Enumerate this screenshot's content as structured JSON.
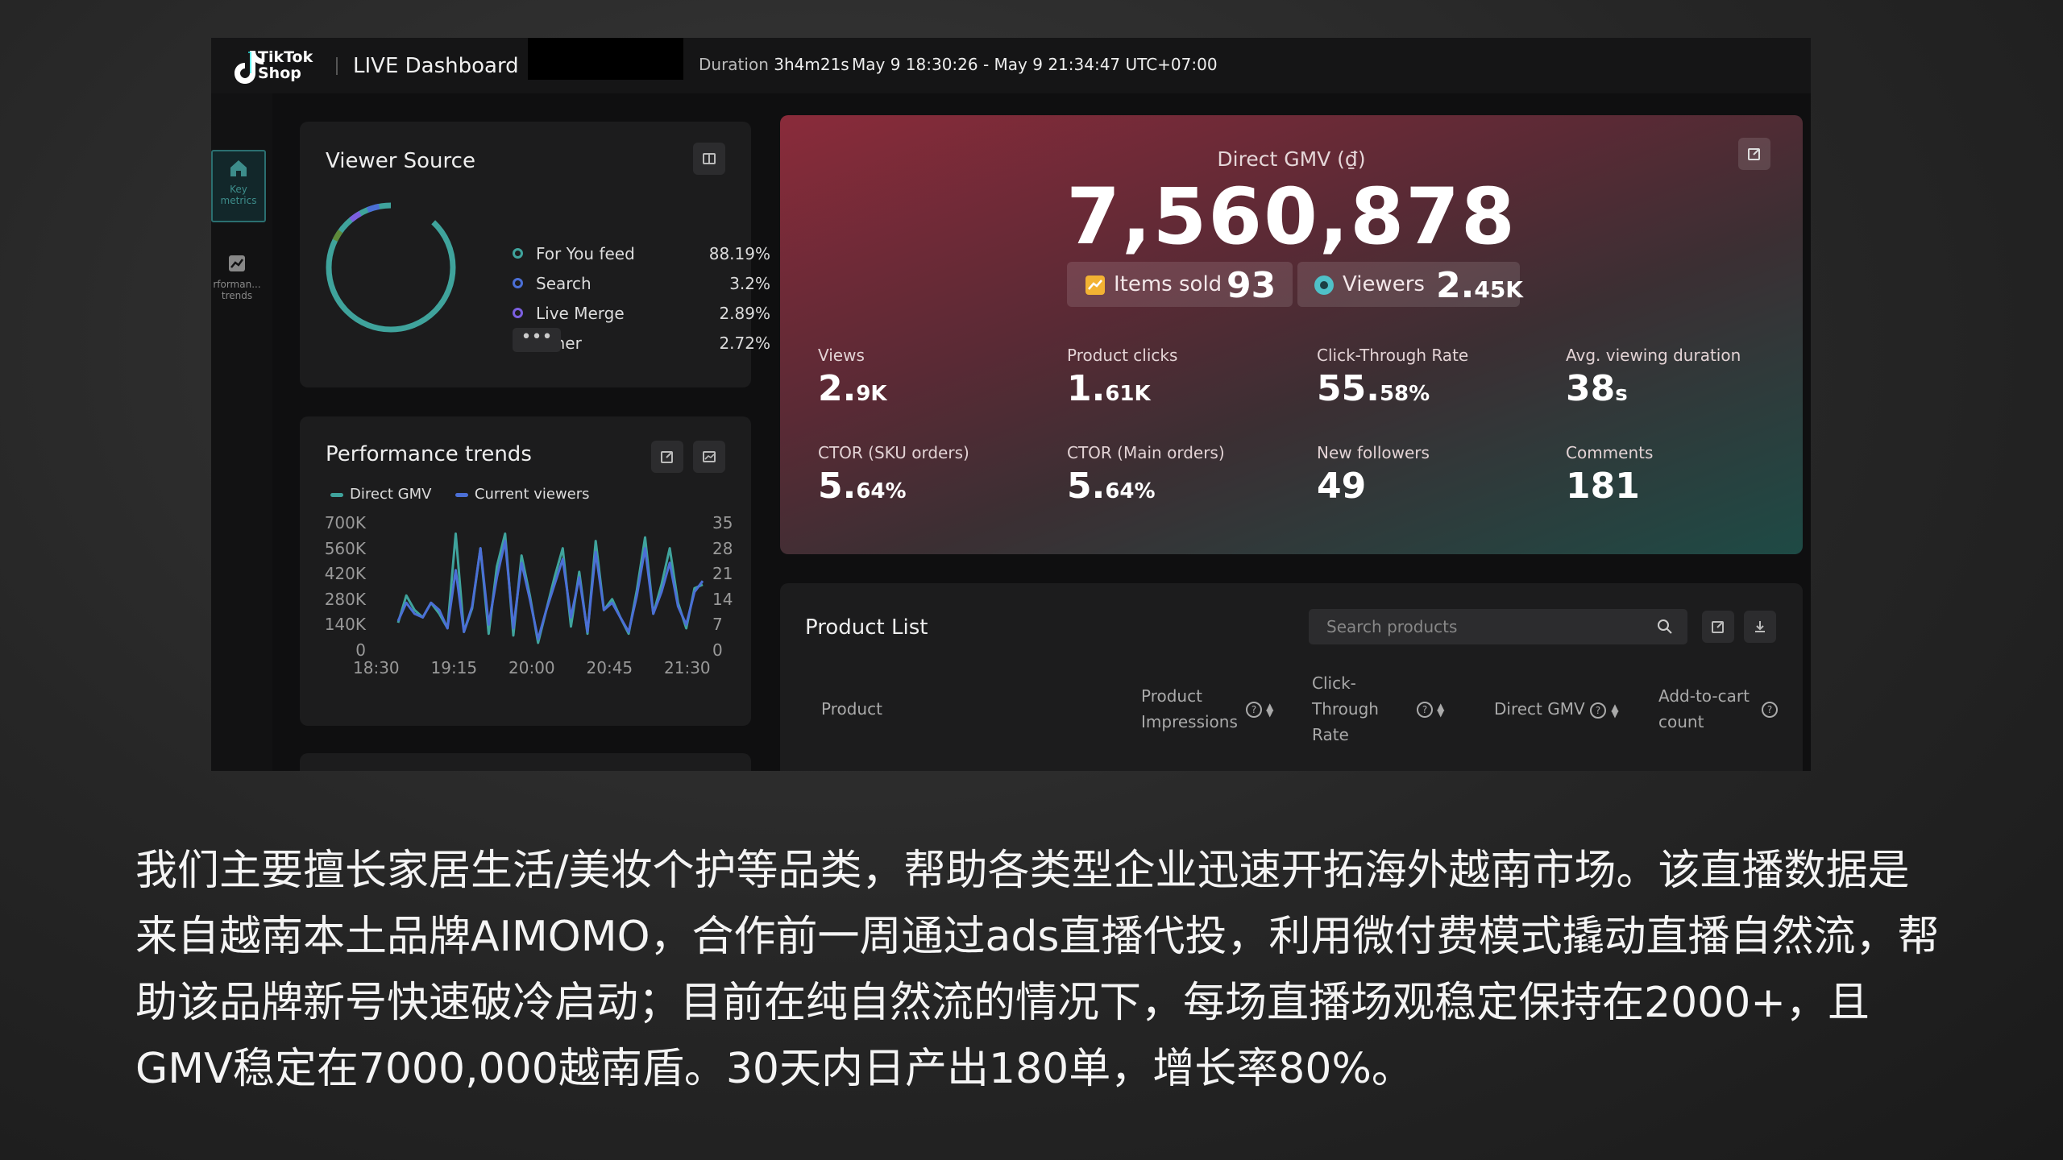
{
  "header": {
    "brand_line1": "TikTok",
    "brand_line2": "Shop",
    "title": "LIVE Dashboard",
    "duration_label": "Duration",
    "duration_value": "3h4m21s",
    "time_range": "May 9 18:30:26 - May 9 21:34:47 UTC+07:00"
  },
  "sidebar": {
    "items": [
      {
        "label": "Key metrics",
        "icon": "home-icon",
        "active": true
      },
      {
        "label": "rforman... trends",
        "icon": "trend-icon",
        "active": false
      }
    ]
  },
  "viewer_source": {
    "title": "Viewer Source",
    "more_label": "•••",
    "items": [
      {
        "label": "For You feed",
        "pct": "88.19%",
        "color": "#3fa39c"
      },
      {
        "label": "Search",
        "pct": "3.2%",
        "color": "#4b6fd6"
      },
      {
        "label": "Live Merge",
        "pct": "2.89%",
        "color": "#7b5fe0"
      },
      {
        "label": "Other",
        "pct": "2.72%",
        "color": "#5f8a3a"
      }
    ]
  },
  "performance": {
    "title": "Performance trends",
    "legend": [
      {
        "name": "Direct GMV",
        "color": "#3fa39c"
      },
      {
        "name": "Current viewers",
        "color": "#4b6fd6"
      }
    ],
    "left_ticks": [
      "700K",
      "560K",
      "420K",
      "280K",
      "140K",
      "0"
    ],
    "right_ticks": [
      "35",
      "28",
      "21",
      "14",
      "7",
      "0"
    ],
    "x_ticks": [
      "18:30",
      "19:15",
      "20:00",
      "20:45",
      "21:30"
    ]
  },
  "chart_data": {
    "type": "line",
    "x": [
      "18:30",
      "18:35",
      "18:40",
      "18:45",
      "18:50",
      "18:55",
      "19:00",
      "19:05",
      "19:10",
      "19:15",
      "19:20",
      "19:25",
      "19:30",
      "19:35",
      "19:40",
      "19:45",
      "19:50",
      "19:55",
      "20:00",
      "20:05",
      "20:10",
      "20:15",
      "20:20",
      "20:25",
      "20:30",
      "20:35",
      "20:40",
      "20:45",
      "20:50",
      "20:55",
      "21:00",
      "21:05",
      "21:10",
      "21:15",
      "21:20",
      "21:25",
      "21:30",
      "21:35"
    ],
    "series": [
      {
        "name": "Direct GMV",
        "axis": "left",
        "values": [
          150000,
          300000,
          220000,
          180000,
          260000,
          200000,
          120000,
          640000,
          100000,
          230000,
          560000,
          90000,
          460000,
          640000,
          80000,
          520000,
          300000,
          40000,
          220000,
          400000,
          560000,
          130000,
          430000,
          90000,
          600000,
          220000,
          280000,
          180000,
          90000,
          330000,
          620000,
          200000,
          360000,
          560000,
          260000,
          120000,
          340000,
          360000
        ]
      },
      {
        "name": "Current viewers",
        "axis": "left",
        "values": [
          8,
          13,
          10,
          9,
          13,
          11,
          6,
          22,
          5,
          12,
          28,
          7,
          20,
          30,
          6,
          24,
          14,
          3,
          11,
          18,
          25,
          9,
          20,
          5,
          27,
          11,
          13,
          9,
          5,
          15,
          28,
          10,
          16,
          24,
          12,
          7,
          16,
          19
        ]
      }
    ],
    "ylim_left": [
      0,
      700000
    ],
    "ylim_right": [
      0,
      35
    ]
  },
  "gmv": {
    "label": "Direct GMV (₫)",
    "value": "7,560,878",
    "items_sold_label": "Items sold",
    "items_sold_value": "93",
    "viewers_label": "Viewers",
    "viewers_value": "2.",
    "viewers_suffix": "45K"
  },
  "metrics": [
    {
      "label": "Views",
      "main": "2.",
      "suffix": "9K"
    },
    {
      "label": "Product clicks",
      "main": "1.",
      "suffix": "61K"
    },
    {
      "label": "Click-Through Rate",
      "main": "55.",
      "suffix": "58%"
    },
    {
      "label": "Avg. viewing duration",
      "main": "38",
      "suffix": "s"
    },
    {
      "label": "CTOR (SKU orders)",
      "main": "5.",
      "suffix": "64%"
    },
    {
      "label": "CTOR (Main orders)",
      "main": "5.",
      "suffix": "64%"
    },
    {
      "label": "New followers",
      "main": "49",
      "suffix": ""
    },
    {
      "label": "Comments",
      "main": "181",
      "suffix": ""
    }
  ],
  "product_list": {
    "title": "Product List",
    "search_placeholder": "Search products",
    "columns": [
      "Product",
      "Product Impressions",
      "Click-Through Rate",
      "Direct GMV",
      "Add-to-cart count"
    ]
  },
  "caption": "我们主要擅长家居生活/美妆个护等品类，帮助各类型企业迅速开拓海外越南市场。该直播数据是来自越南本土品牌AIMOMO，合作前一周通过ads直播代投，利用微付费模式撬动直播自然流，帮助该品牌新号快速破冷启动；目前在纯自然流的情况下，每场直播场观稳定保持在2000+，且GMV稳定在7000,000越南盾。30天内日产出180单，增长率80%。"
}
